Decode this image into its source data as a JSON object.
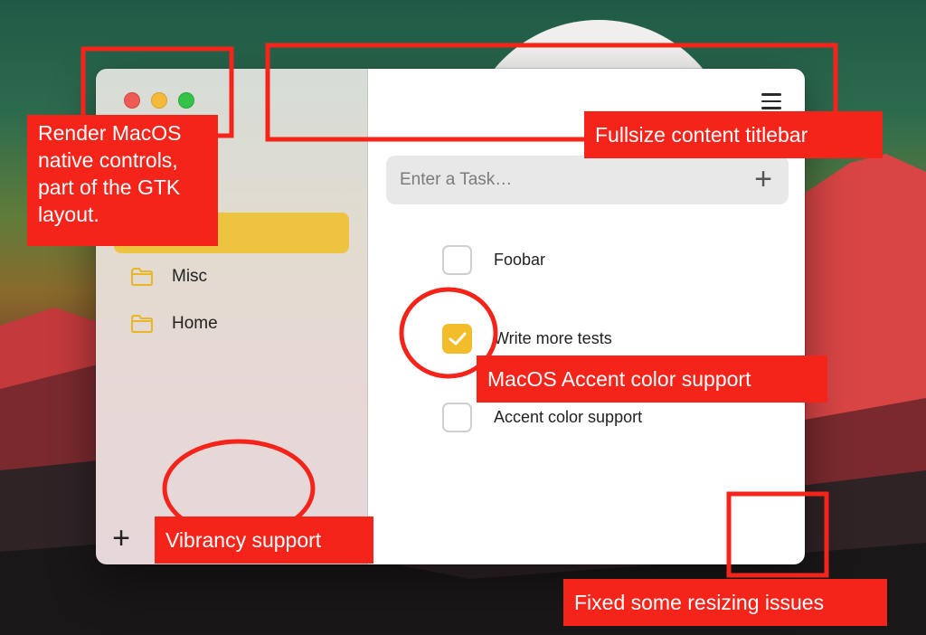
{
  "window": {
    "traffic_lights": [
      "close",
      "minimize",
      "zoom"
    ],
    "accent_color": "#f2bc2a"
  },
  "sidebar": {
    "items": [
      {
        "label": "",
        "icon": "folder-icon",
        "selected": true
      },
      {
        "label": "Misc",
        "icon": "folder-icon"
      },
      {
        "label": "Home",
        "icon": "folder-icon"
      }
    ],
    "add_label": "+"
  },
  "main": {
    "menu_icon": "hamburger-menu-icon",
    "task_input": {
      "placeholder": "Enter a Task…",
      "value": ""
    },
    "add_label": "+",
    "tasks": [
      {
        "label": "Foobar",
        "checked": false
      },
      {
        "label": "Write more tests",
        "checked": true
      },
      {
        "label": "Accent color support",
        "checked": false
      }
    ]
  },
  "annotations": {
    "native_controls": "Render MacOS native controls, part of the GTK layout.",
    "titlebar": "Fullsize content titlebar",
    "accent": "MacOS Accent color support",
    "vibrancy": "Vibrancy support",
    "resizing": "Fixed some resizing issues"
  }
}
